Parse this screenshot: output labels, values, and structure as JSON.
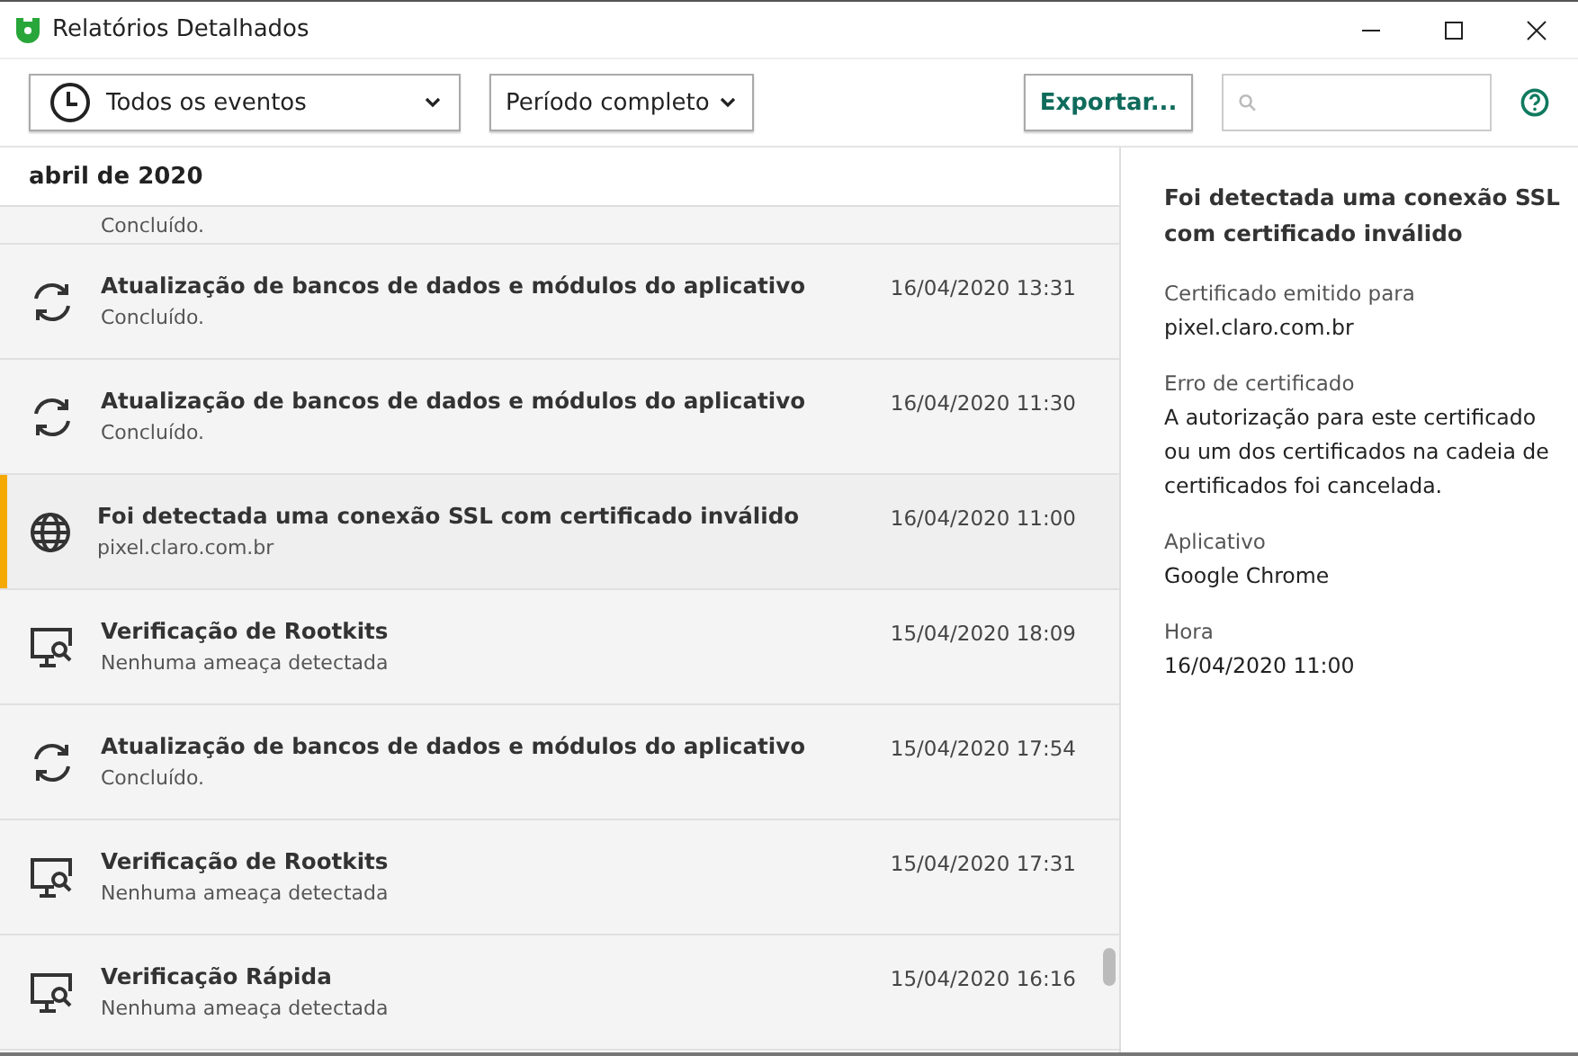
{
  "window": {
    "title": "Relatórios Detalhados"
  },
  "toolbar": {
    "event_filter": "Todos os eventos",
    "period_filter": "Período completo",
    "export_button": "Exportar..."
  },
  "list": {
    "month_header": "abril de 2020",
    "partial_row": {
      "subtitle": "Concluído."
    },
    "rows": [
      {
        "kind": "update",
        "title": "Atualização de bancos de dados e módulos do aplicativo",
        "subtitle": "Concluído.",
        "time": "16/04/2020 13:31",
        "selected": false
      },
      {
        "kind": "update",
        "title": "Atualização de bancos de dados e módulos do aplicativo",
        "subtitle": "Concluído.",
        "time": "16/04/2020 11:30",
        "selected": false
      },
      {
        "kind": "network",
        "title": "Foi detectada uma conexão SSL com certificado inválido",
        "subtitle": "pixel.claro.com.br",
        "time": "16/04/2020 11:00",
        "selected": true
      },
      {
        "kind": "scan",
        "title": "Verificação de Rootkits",
        "subtitle": "Nenhuma ameaça detectada",
        "time": "15/04/2020 18:09",
        "selected": false
      },
      {
        "kind": "update",
        "title": "Atualização de bancos de dados e módulos do aplicativo",
        "subtitle": "Concluído.",
        "time": "15/04/2020 17:54",
        "selected": false
      },
      {
        "kind": "scan",
        "title": "Verificação de Rootkits",
        "subtitle": "Nenhuma ameaça detectada",
        "time": "15/04/2020 17:31",
        "selected": false
      },
      {
        "kind": "scan",
        "title": "Verificação Rápida",
        "subtitle": "Nenhuma ameaça detectada",
        "time": "15/04/2020 16:16",
        "selected": false
      }
    ]
  },
  "details": {
    "title": "Foi detectada uma conexão SSL com certificado inválido",
    "fields": [
      {
        "label": "Certificado emitido para",
        "value": "pixel.claro.com.br"
      },
      {
        "label": "Erro de certificado",
        "value": "A autorização para este certificado ou um dos certificados na cadeia de certificados foi cancelada."
      },
      {
        "label": "Aplicativo",
        "value": "Google Chrome"
      },
      {
        "label": "Hora",
        "value": "16/04/2020 11:00"
      }
    ]
  }
}
